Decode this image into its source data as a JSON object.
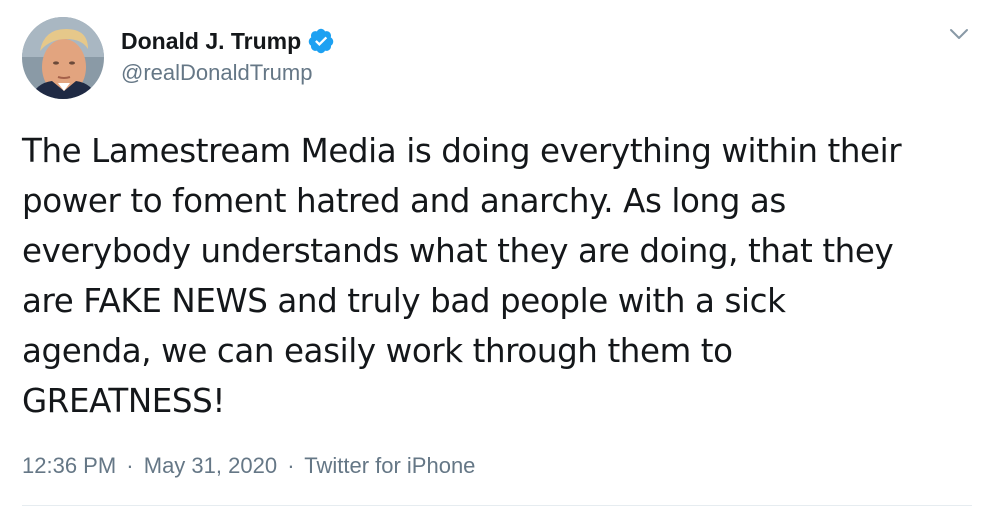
{
  "author": {
    "display_name": "Donald J. Trump",
    "handle": "@realDonaldTrump",
    "verified": true,
    "avatar_icon": "profile-photo"
  },
  "tweet": {
    "text": "The Lamestream Media is doing everything within their\npower to foment hatred and anarchy. As long as\neverybody understands what they are doing, that they\nare FAKE NEWS and truly bad people with a sick\nagenda, we can easily work through them to\nGREATNESS!"
  },
  "meta": {
    "time": "12:36 PM",
    "date": "May 31, 2020",
    "source": "Twitter for iPhone",
    "separator": "·"
  },
  "icons": {
    "verified": "verified-badge-icon",
    "menu": "chevron-down-icon"
  },
  "colors": {
    "text": "#14171a",
    "secondary": "#657786",
    "verified_blue": "#1da1f2",
    "divider": "#e6ecf0"
  }
}
